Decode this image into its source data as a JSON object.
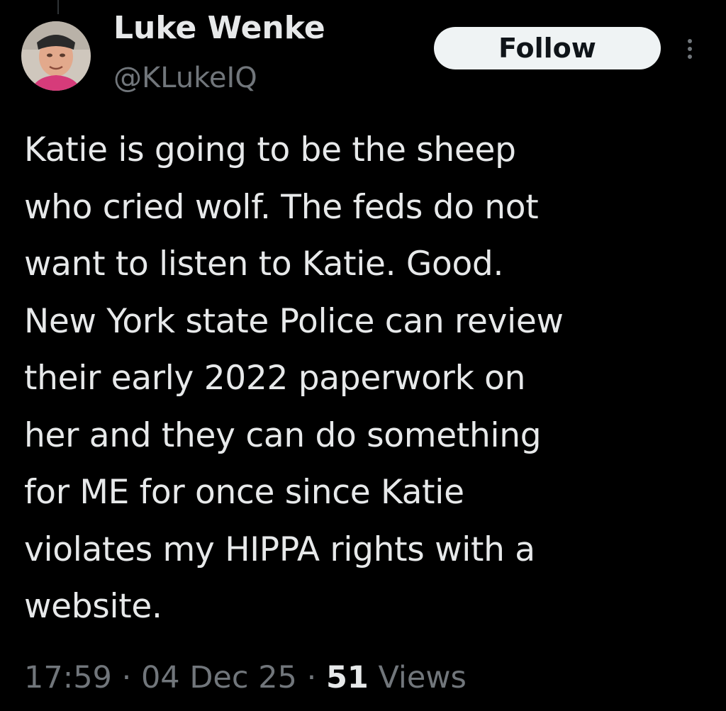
{
  "author": {
    "name": "Luke Wenke",
    "handle": "@KLukeIQ"
  },
  "follow_button": {
    "label": "Follow"
  },
  "more_button": {
    "icon": "more-vertical-icon"
  },
  "tweet": {
    "text": "Katie is going to be the sheep\nwho cried wolf.  The feds do not\nwant to listen to Katie.  Good.\nNew York state Police can review\ntheir early 2022 paperwork on\nher and they can do something\nfor ME for once since Katie\nviolates my HIPPA rights with a\nwebsite."
  },
  "meta": {
    "time": "17:59",
    "separator": "·",
    "date": "04 Dec 25",
    "views_count": "51",
    "views_label": "Views"
  },
  "colors": {
    "background": "#000000",
    "primary_text": "#e7e9ea",
    "secondary_text": "#71767b",
    "follow_button_bg": "#eff3f4",
    "follow_button_text": "#0f1419"
  }
}
